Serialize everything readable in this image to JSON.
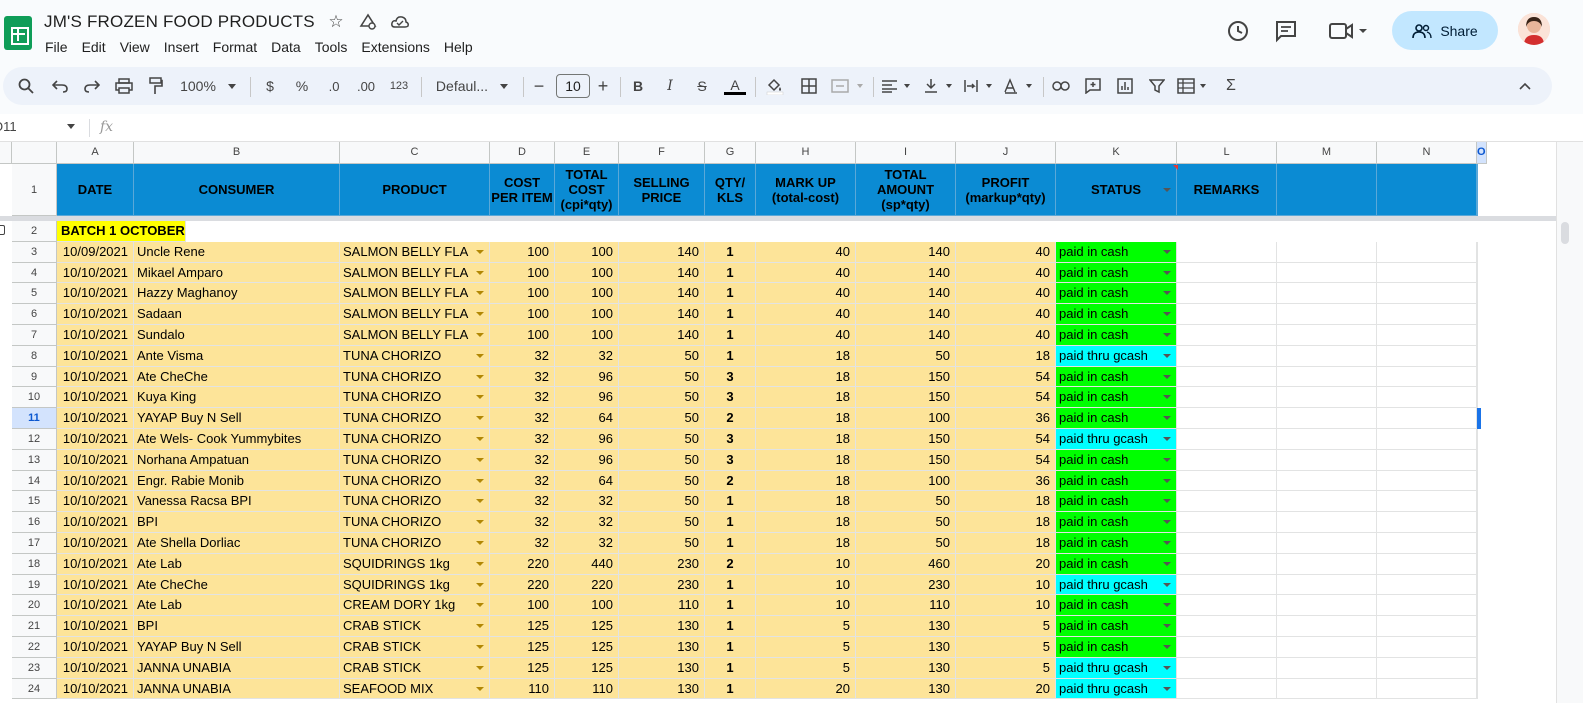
{
  "doc": {
    "title": "JM'S FROZEN FOOD PRODUCTS",
    "menus": [
      "File",
      "Edit",
      "View",
      "Insert",
      "Format",
      "Data",
      "Tools",
      "Extensions",
      "Help"
    ],
    "share_label": "Share"
  },
  "toolbar": {
    "zoom": "100%",
    "currency": "$",
    "percent": "%",
    "dec_decrease": ".0",
    "dec_increase": ".00",
    "number_format": "123",
    "font": "Defaul...",
    "font_size": "10",
    "bold": "B",
    "italic": "I",
    "strike": "S",
    "text_color": "A",
    "sum": "Σ"
  },
  "formula_bar": {
    "name_box": "O11",
    "fx": "fx"
  },
  "colors": {
    "header_bg": "#0b8bd3",
    "batch_bg": "#ffff00",
    "row_bg": "#fde499",
    "paid_cash": "#00ff00",
    "paid_gcash": "#00ffff",
    "accent": "#1a73e8"
  },
  "grid": {
    "columns": [
      "A",
      "B",
      "C",
      "D",
      "E",
      "F",
      "G",
      "H",
      "I",
      "J",
      "K",
      "L",
      "M",
      "N",
      "O"
    ],
    "selected_column": "O",
    "selected_row": "11",
    "headers": [
      "DATE",
      "CONSUMER",
      "PRODUCT",
      "COST PER ITEM",
      "TOTAL COST (cpi*qty)",
      "SELLING PRICE",
      "QTY/ KLS",
      "MARK UP (total-cost)",
      "TOTAL AMOUNT (sp*qty)",
      "PROFIT (markup*qty)",
      "STATUS",
      "REMARKS"
    ],
    "header_row_num": "1",
    "batch_row_num": "2",
    "batch_label": "BATCH 1 OCTOBER",
    "rows": [
      {
        "n": "3",
        "date": "10/09/2021",
        "consumer": "Uncle Rene",
        "product": "SALMON BELLY FLA",
        "cost": "100",
        "total_cost": "100",
        "price": "140",
        "qty": "1",
        "markup": "40",
        "amount": "140",
        "profit": "40",
        "status": "paid in cash"
      },
      {
        "n": "4",
        "date": "10/10/2021",
        "consumer": "Mikael Amparo",
        "product": "SALMON BELLY FLA",
        "cost": "100",
        "total_cost": "100",
        "price": "140",
        "qty": "1",
        "markup": "40",
        "amount": "140",
        "profit": "40",
        "status": "paid in cash"
      },
      {
        "n": "5",
        "date": "10/10/2021",
        "consumer": "Hazzy Maghanoy",
        "product": "SALMON BELLY FLA",
        "cost": "100",
        "total_cost": "100",
        "price": "140",
        "qty": "1",
        "markup": "40",
        "amount": "140",
        "profit": "40",
        "status": "paid in cash"
      },
      {
        "n": "6",
        "date": "10/10/2021",
        "consumer": "Sadaan",
        "product": "SALMON BELLY FLA",
        "cost": "100",
        "total_cost": "100",
        "price": "140",
        "qty": "1",
        "markup": "40",
        "amount": "140",
        "profit": "40",
        "status": "paid in cash"
      },
      {
        "n": "7",
        "date": "10/10/2021",
        "consumer": "Sundalo",
        "product": "SALMON BELLY FLA",
        "cost": "100",
        "total_cost": "100",
        "price": "140",
        "qty": "1",
        "markup": "40",
        "amount": "140",
        "profit": "40",
        "status": "paid in cash"
      },
      {
        "n": "8",
        "date": "10/10/2021",
        "consumer": "Ante Visma",
        "product": "TUNA CHORIZO",
        "cost": "32",
        "total_cost": "32",
        "price": "50",
        "qty": "1",
        "markup": "18",
        "amount": "50",
        "profit": "18",
        "status": "paid thru gcash"
      },
      {
        "n": "9",
        "date": "10/10/2021",
        "consumer": "Ate CheChe",
        "product": "TUNA CHORIZO",
        "cost": "32",
        "total_cost": "96",
        "price": "50",
        "qty": "3",
        "markup": "18",
        "amount": "150",
        "profit": "54",
        "status": "paid in cash"
      },
      {
        "n": "10",
        "date": "10/10/2021",
        "consumer": "Kuya King",
        "product": "TUNA CHORIZO",
        "cost": "32",
        "total_cost": "96",
        "price": "50",
        "qty": "3",
        "markup": "18",
        "amount": "150",
        "profit": "54",
        "status": "paid in cash"
      },
      {
        "n": "11",
        "date": "10/10/2021",
        "consumer": "YAYAP Buy N Sell",
        "product": "TUNA CHORIZO",
        "cost": "32",
        "total_cost": "64",
        "price": "50",
        "qty": "2",
        "markup": "18",
        "amount": "100",
        "profit": "36",
        "status": "paid in cash"
      },
      {
        "n": "12",
        "date": "10/10/2021",
        "consumer": "Ate Wels- Cook Yummybites",
        "product": "TUNA CHORIZO",
        "cost": "32",
        "total_cost": "96",
        "price": "50",
        "qty": "3",
        "markup": "18",
        "amount": "150",
        "profit": "54",
        "status": "paid thru gcash"
      },
      {
        "n": "13",
        "date": "10/10/2021",
        "consumer": "Norhana Ampatuan",
        "product": "TUNA CHORIZO",
        "cost": "32",
        "total_cost": "96",
        "price": "50",
        "qty": "3",
        "markup": "18",
        "amount": "150",
        "profit": "54",
        "status": "paid in cash"
      },
      {
        "n": "14",
        "date": "10/10/2021",
        "consumer": "Engr. Rabie Monib",
        "product": "TUNA CHORIZO",
        "cost": "32",
        "total_cost": "64",
        "price": "50",
        "qty": "2",
        "markup": "18",
        "amount": "100",
        "profit": "36",
        "status": "paid in cash"
      },
      {
        "n": "15",
        "date": "10/10/2021",
        "consumer": "Vanessa Racsa BPI",
        "product": "TUNA CHORIZO",
        "cost": "32",
        "total_cost": "32",
        "price": "50",
        "qty": "1",
        "markup": "18",
        "amount": "50",
        "profit": "18",
        "status": "paid in cash"
      },
      {
        "n": "16",
        "date": "10/10/2021",
        "consumer": "BPI",
        "product": "TUNA CHORIZO",
        "cost": "32",
        "total_cost": "32",
        "price": "50",
        "qty": "1",
        "markup": "18",
        "amount": "50",
        "profit": "18",
        "status": "paid in cash"
      },
      {
        "n": "17",
        "date": "10/10/2021",
        "consumer": "Ate Shella Dorliac",
        "product": "TUNA CHORIZO",
        "cost": "32",
        "total_cost": "32",
        "price": "50",
        "qty": "1",
        "markup": "18",
        "amount": "50",
        "profit": "18",
        "status": "paid in cash"
      },
      {
        "n": "18",
        "date": "10/10/2021",
        "consumer": "Ate Lab",
        "product": "SQUIDRINGS 1kg",
        "cost": "220",
        "total_cost": "440",
        "price": "230",
        "qty": "2",
        "markup": "10",
        "amount": "460",
        "profit": "20",
        "status": "paid in cash"
      },
      {
        "n": "19",
        "date": "10/10/2021",
        "consumer": "Ate CheChe",
        "product": "SQUIDRINGS 1kg",
        "cost": "220",
        "total_cost": "220",
        "price": "230",
        "qty": "1",
        "markup": "10",
        "amount": "230",
        "profit": "10",
        "status": "paid thru gcash"
      },
      {
        "n": "20",
        "date": "10/10/2021",
        "consumer": "Ate Lab",
        "product": "CREAM DORY 1kg",
        "cost": "100",
        "total_cost": "100",
        "price": "110",
        "qty": "1",
        "markup": "10",
        "amount": "110",
        "profit": "10",
        "status": "paid in cash"
      },
      {
        "n": "21",
        "date": "10/10/2021",
        "consumer": "BPI",
        "product": "CRAB STICK",
        "cost": "125",
        "total_cost": "125",
        "price": "130",
        "qty": "1",
        "markup": "5",
        "amount": "130",
        "profit": "5",
        "status": "paid in cash"
      },
      {
        "n": "22",
        "date": "10/10/2021",
        "consumer": "YAYAP Buy N Sell",
        "product": "CRAB STICK",
        "cost": "125",
        "total_cost": "125",
        "price": "130",
        "qty": "1",
        "markup": "5",
        "amount": "130",
        "profit": "5",
        "status": "paid in cash"
      },
      {
        "n": "23",
        "date": "10/10/2021",
        "consumer": "JANNA UNABIA",
        "product": "CRAB STICK",
        "cost": "125",
        "total_cost": "125",
        "price": "130",
        "qty": "1",
        "markup": "5",
        "amount": "130",
        "profit": "5",
        "status": "paid thru gcash"
      },
      {
        "n": "24",
        "date": "10/10/2021",
        "consumer": "JANNA UNABIA",
        "product": "SEAFOOD MIX",
        "cost": "110",
        "total_cost": "110",
        "price": "130",
        "qty": "1",
        "markup": "20",
        "amount": "130",
        "profit": "20",
        "status": "paid thru gcash"
      }
    ]
  }
}
